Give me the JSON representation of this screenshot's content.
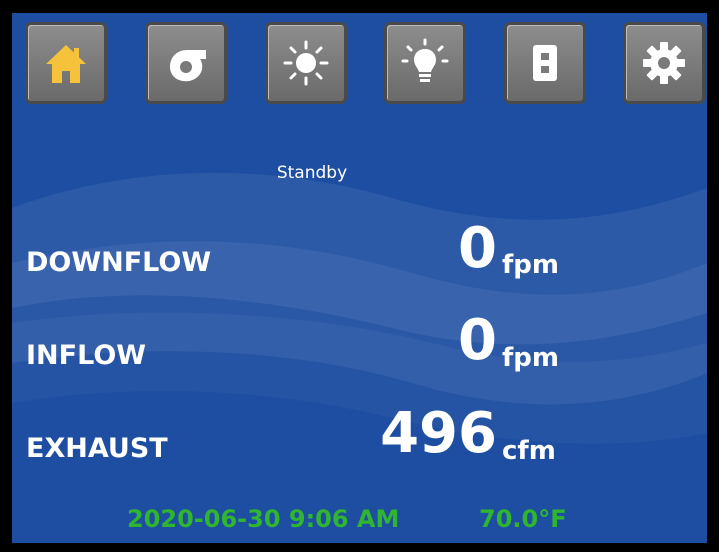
{
  "colors": {
    "panel_background": "#1e4ea1",
    "button_face": "#7a7a7a",
    "home_icon_active": "#f6c23b",
    "icon_default": "#ffffff",
    "footer_text": "#2fb52f"
  },
  "toolbar": {
    "buttons": [
      {
        "icon": "home-icon",
        "active": true
      },
      {
        "icon": "fan-blower-icon",
        "active": false
      },
      {
        "icon": "sun-uv-light-icon",
        "active": false
      },
      {
        "icon": "lightbulb-icon",
        "active": false
      },
      {
        "icon": "outlet-icon",
        "active": false
      },
      {
        "icon": "gear-icon",
        "active": false
      }
    ]
  },
  "status": "Standby",
  "readings": {
    "downflow": {
      "label": "DOWNFLOW",
      "value": "0",
      "unit": "fpm"
    },
    "inflow": {
      "label": "INFLOW",
      "value": "0",
      "unit": "fpm"
    },
    "exhaust": {
      "label": "EXHAUST",
      "value": "496",
      "unit": "cfm"
    }
  },
  "footer": {
    "datetime": "2020-06-30 9:06 AM",
    "temperature": "70.0°F"
  }
}
